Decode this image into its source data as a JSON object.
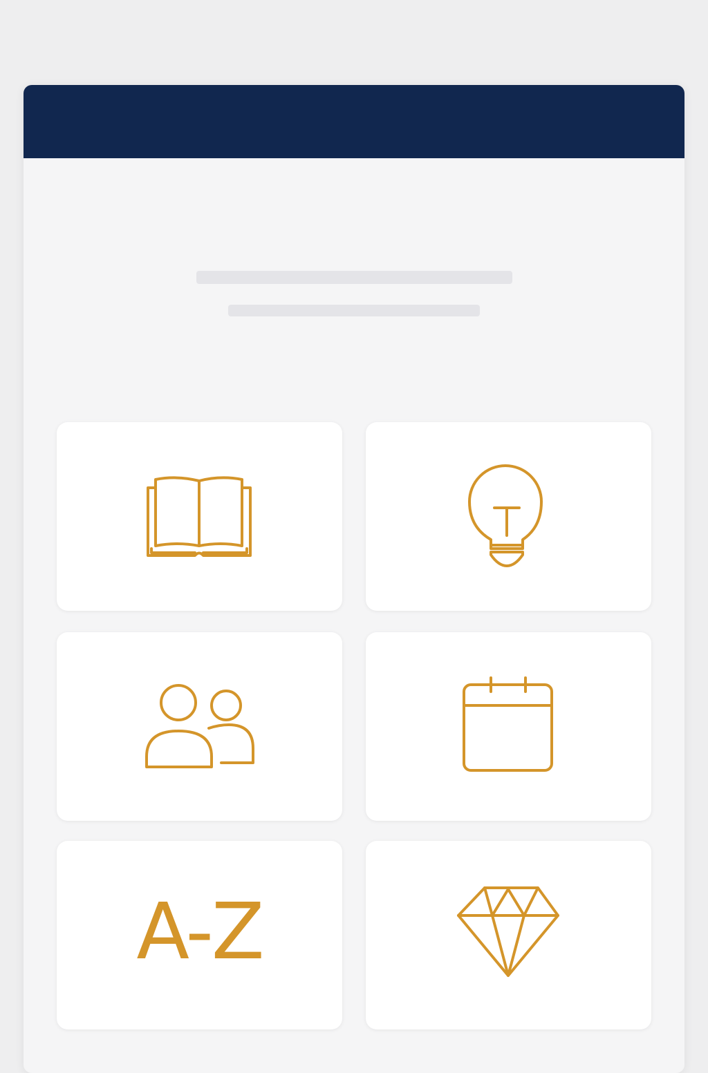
{
  "theme": {
    "header_color": "#11274f",
    "accent_color": "#d4952a"
  },
  "tiles": [
    {
      "icon": "open-book-icon"
    },
    {
      "icon": "lightbulb-icon"
    },
    {
      "icon": "users-icon"
    },
    {
      "icon": "calendar-icon"
    },
    {
      "icon": "a-z-glossary-icon",
      "label": "A-Z"
    },
    {
      "icon": "diamond-icon"
    }
  ]
}
